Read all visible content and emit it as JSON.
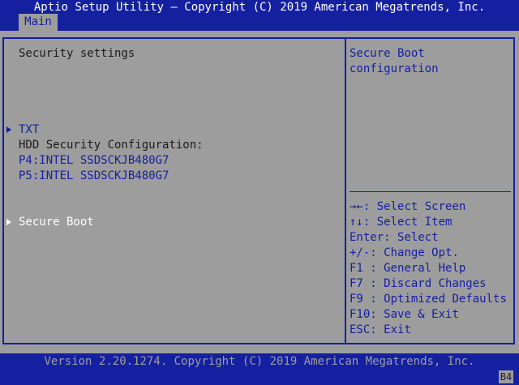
{
  "header": {
    "title": "Aptio Setup Utility – Copyright (C) 2019 American Megatrends, Inc.",
    "tabs": [
      {
        "label": "Main"
      }
    ]
  },
  "main": {
    "section_title": "Security settings",
    "items": {
      "txt": "TXT",
      "hdd_heading": "HDD Security Configuration:",
      "p4": "P4:INTEL SSDSCKJB480G7",
      "p5": "P5:INTEL SSDSCKJB480G7",
      "secure_boot": "Secure Boot"
    }
  },
  "help": {
    "description": [
      "Secure Boot",
      "configuration"
    ],
    "keys": [
      {
        "key": "→←:",
        "action": "Select Screen"
      },
      {
        "key": "↑↓:",
        "action": "Select Item"
      },
      {
        "key": "Enter:",
        "action": "Select"
      },
      {
        "key": "+/-:",
        "action": "Change Opt."
      },
      {
        "key": "F1 :",
        "action": "General Help"
      },
      {
        "key": "F7 :",
        "action": "Discard Changes"
      },
      {
        "key": "F9 :",
        "action": "Optimized Defaults"
      },
      {
        "key": "F10:",
        "action": "Save & Exit"
      },
      {
        "key": "ESC:",
        "action": "Exit"
      }
    ]
  },
  "footer": {
    "version": "Version 2.20.1274. Copyright (C) 2019 American Megatrends, Inc.",
    "badge": "B4"
  },
  "colors": {
    "background": "#9d9d9d",
    "accent_blue": "#1520a0",
    "selected_text": "#ffffff"
  }
}
